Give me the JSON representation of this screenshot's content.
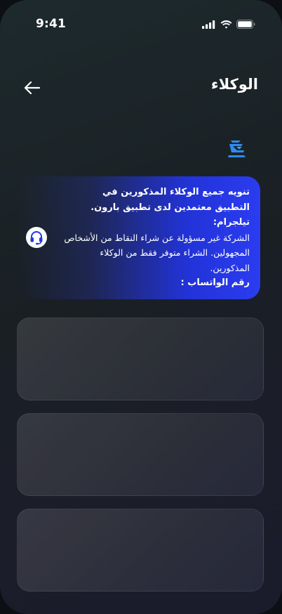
{
  "status_bar": {
    "time": "9:41"
  },
  "header": {
    "title": "الوكلاء",
    "back_icon": "arrow-left-icon"
  },
  "logo": {
    "icon": "brand-logo-icon",
    "color": "#2d8cf0"
  },
  "notice": {
    "line1": "تنويه جميع الوكلاء المذكورين في",
    "line2": "التطبيق معتمدين لدى تطبيق بارون.",
    "telegram_label": "تيلجرام:",
    "body": "الشركة غير مسؤولة عن شراء النقاط من الأشخاص المجهولين. الشراء متوفر فقط من الوكلاء المذكورين.",
    "whatsapp_label": "رقم الواتساب :",
    "support_icon": "headset-support-icon",
    "accent_color": "#2b3cf0"
  },
  "agents": [
    {},
    {},
    {}
  ]
}
